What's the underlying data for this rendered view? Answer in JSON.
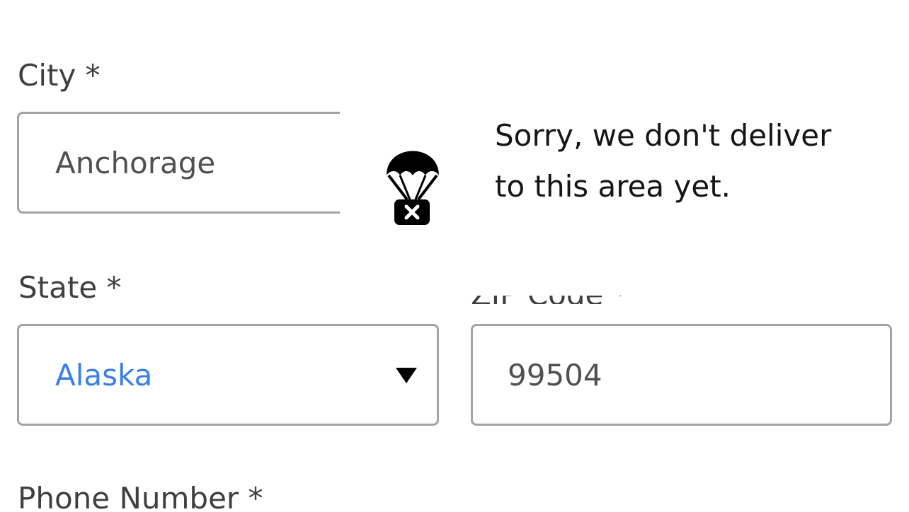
{
  "form": {
    "city": {
      "label": "City *",
      "value": "Anchorage"
    },
    "state": {
      "label": "State *",
      "value": "Alaska"
    },
    "zip": {
      "label": "ZIP Code *",
      "value": "99504"
    },
    "phone": {
      "label": "Phone Number *"
    }
  },
  "tooltip": {
    "message": "Sorry, we don't deliver to this area yet.",
    "icon": "parachute-box-x-icon"
  },
  "colors": {
    "select_value": "#3b7ee8",
    "field_border": "#a3a3a3",
    "label_text": "#3f3f3f"
  }
}
